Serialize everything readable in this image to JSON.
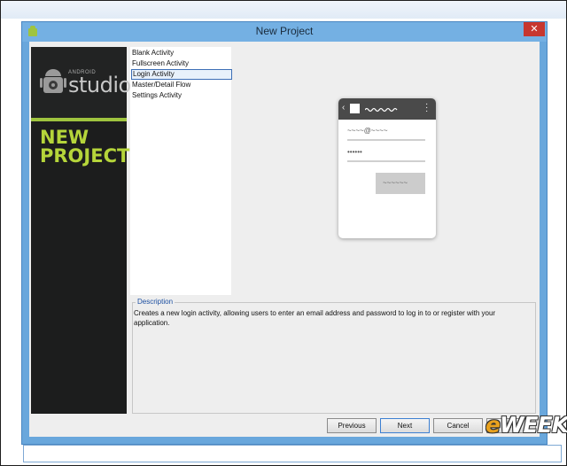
{
  "window": {
    "title": "New Project",
    "close_label": "✕"
  },
  "sidebar": {
    "brand_small": "ANDROID",
    "brand_big": "studio",
    "heading_line1": "NEW",
    "heading_line2": "PROJECT"
  },
  "templates": {
    "items": [
      {
        "label": "Blank Activity"
      },
      {
        "label": "Fullscreen Activity"
      },
      {
        "label": "Login Activity",
        "selected": true
      },
      {
        "label": "Master/Detail Flow"
      },
      {
        "label": "Settings Activity"
      }
    ]
  },
  "preview": {
    "email_placeholder": "~~~~@~~~~",
    "password_placeholder": "••••••",
    "button_squiggle": "~~~~~~"
  },
  "description": {
    "legend": "Description",
    "text": "Creates a new login activity, allowing users to enter an email address and password to log in to or register with your application."
  },
  "buttons": {
    "previous": "Previous",
    "next": "Next",
    "cancel": "Cancel",
    "finish": "Finish"
  },
  "watermark": {
    "text_e": "e",
    "text_rest": "WEEK"
  },
  "colors": {
    "titlebar": "#74b0e3",
    "accent_green": "#9fc43f",
    "close": "#c7372f"
  }
}
